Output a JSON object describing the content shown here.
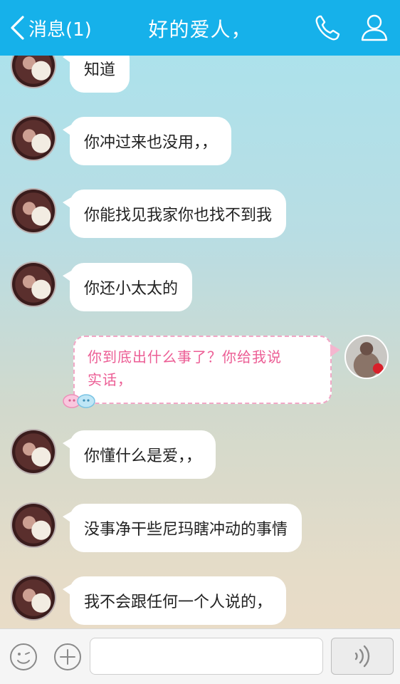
{
  "header": {
    "back_label": "消息(1)",
    "title": "好的爱人，",
    "phone_icon": "phone-icon",
    "profile_icon": "profile-icon",
    "bar_color": "#16b1ea"
  },
  "messages": [
    {
      "side": "received",
      "text": "知道"
    },
    {
      "side": "received",
      "text": "你冲过来也没用，，"
    },
    {
      "side": "received",
      "text": "你能找见我家你也找不到我"
    },
    {
      "side": "received",
      "text": "你还小太太的"
    },
    {
      "side": "sent",
      "line1": "你到底出什么事了？你给我说",
      "line2": "实话，"
    },
    {
      "side": "received",
      "text": "你懂什么是爱，，"
    },
    {
      "side": "received",
      "text": "没事净干些尼玛瞎冲动的事情"
    },
    {
      "side": "received",
      "text": "我不会跟任何一个人说的，"
    }
  ],
  "input_bar": {
    "emoji_icon": "emoji-icon",
    "plus_icon": "plus-icon",
    "voice_icon": "voice-icon",
    "text_value": ""
  },
  "colors": {
    "sent_text": "#ec5e95",
    "sent_border": "#f1a7c6"
  }
}
